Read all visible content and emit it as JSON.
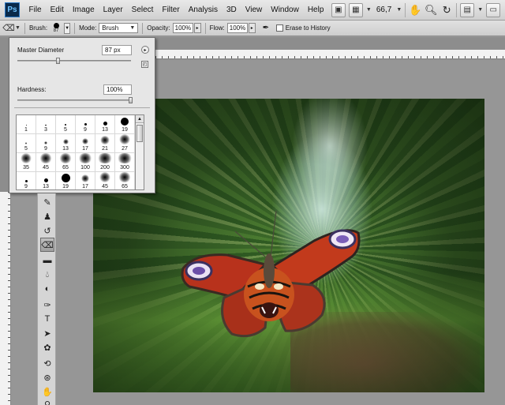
{
  "app": {
    "logo": "Ps"
  },
  "menu": [
    "File",
    "Edit",
    "Image",
    "Layer",
    "Select",
    "Filter",
    "Analysis",
    "3D",
    "View",
    "Window",
    "Help"
  ],
  "appbar": {
    "zoom": "66,7"
  },
  "options": {
    "brush_label": "Brush:",
    "brush_size": "87",
    "mode_label": "Mode:",
    "mode_value": "Brush",
    "opacity_label": "Opacity:",
    "opacity_value": "100%",
    "flow_label": "Flow:",
    "flow_value": "100%",
    "erase_history_label": "Erase to History"
  },
  "brush_panel": {
    "master_diameter_label": "Master Diameter",
    "master_diameter_value": "87 px",
    "master_diameter_level": 0.36,
    "hardness_label": "Hardness:",
    "hardness_value": "100%",
    "hardness_level": 1.0,
    "presets": [
      {
        "size": "1",
        "d": 1,
        "soft": false
      },
      {
        "size": "3",
        "d": 1.5,
        "soft": false
      },
      {
        "size": "5",
        "d": 2,
        "soft": false
      },
      {
        "size": "9",
        "d": 3,
        "soft": false
      },
      {
        "size": "13",
        "d": 5,
        "soft": false
      },
      {
        "size": "19",
        "d": 10,
        "soft": false
      },
      {
        "size": "5",
        "d": 2,
        "soft": true
      },
      {
        "size": "9",
        "d": 3,
        "soft": true
      },
      {
        "size": "13",
        "d": 5,
        "soft": true
      },
      {
        "size": "17",
        "d": 6,
        "soft": true
      },
      {
        "size": "21",
        "d": 8,
        "soft": true
      },
      {
        "size": "27",
        "d": 10,
        "soft": true
      },
      {
        "size": "35",
        "d": 10,
        "soft": true
      },
      {
        "size": "45",
        "d": 11,
        "soft": true
      },
      {
        "size": "65",
        "d": 12,
        "soft": true
      },
      {
        "size": "100",
        "d": 13,
        "soft": true
      },
      {
        "size": "200",
        "d": 14,
        "soft": true
      },
      {
        "size": "300",
        "d": 14,
        "soft": true
      },
      {
        "size": "9",
        "d": 3,
        "soft": false
      },
      {
        "size": "13",
        "d": 5,
        "soft": false
      },
      {
        "size": "19",
        "d": 11,
        "soft": false
      },
      {
        "size": "17",
        "d": 7,
        "soft": true
      },
      {
        "size": "45",
        "d": 10,
        "soft": true
      },
      {
        "size": "65",
        "d": 11,
        "soft": true
      }
    ]
  }
}
